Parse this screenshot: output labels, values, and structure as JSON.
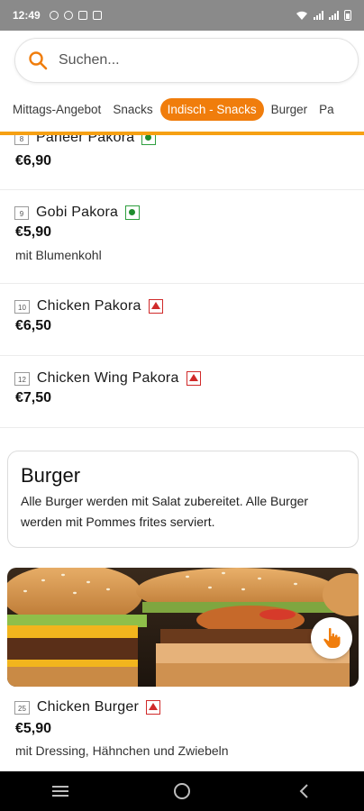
{
  "status_bar": {
    "time": "12:49"
  },
  "search": {
    "placeholder": "Suchen..."
  },
  "tabs": [
    {
      "label": "Mittags-Angebot"
    },
    {
      "label": "Snacks"
    },
    {
      "label": "Indisch - Snacks"
    },
    {
      "label": "Burger"
    },
    {
      "label": "Pa"
    }
  ],
  "active_tab": "Indisch - Snacks",
  "items": [
    {
      "number": "8",
      "name": "Paneer Pakora",
      "type": "veg",
      "price": "€6,90",
      "description": ""
    },
    {
      "number": "9",
      "name": "Gobi Pakora",
      "type": "veg",
      "price": "€5,90",
      "description": "mit Blumenkohl"
    },
    {
      "number": "10",
      "name": "Chicken Pakora",
      "type": "non-veg",
      "price": "€6,50",
      "description": ""
    },
    {
      "number": "12",
      "name": "Chicken Wing Pakora",
      "type": "non-veg",
      "price": "€7,50",
      "description": ""
    }
  ],
  "category": {
    "title": "Burger",
    "description": "Alle Burger werden mit Salat zubereitet. Alle Burger werden mit Pommes frites serviert."
  },
  "burger_item": {
    "number": "25",
    "name": "Chicken Burger",
    "type": "non-veg",
    "price": "€5,90",
    "description": "mit Dressing, Hähnchen und Zwiebeln"
  },
  "colors": {
    "accent": "#f07d0c",
    "underline": "#f6a013",
    "veg": "#1f8c2e",
    "non_veg": "#d02a2a"
  },
  "icons": {
    "search": "search-icon",
    "hand": "hand-pointer-icon",
    "nav_menu": "menu-icon",
    "nav_home": "home-icon",
    "nav_back": "back-icon"
  }
}
